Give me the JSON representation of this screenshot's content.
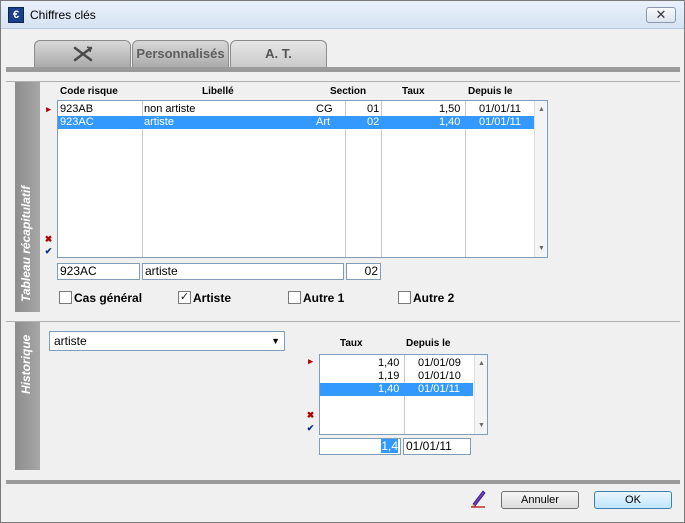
{
  "window": {
    "title": "Chiffres clés"
  },
  "tabs": [
    {
      "label": ""
    },
    {
      "label": "Personnalisés"
    },
    {
      "label": "A. T."
    }
  ],
  "summary": {
    "section_label": "Tableau récapitulatif",
    "columns": [
      "Code risque",
      "Libellé",
      "Section",
      "Taux",
      "Depuis le"
    ],
    "rows": [
      {
        "code": "923AB",
        "libelle": "non artiste",
        "section_code": "CG",
        "section_num": "01",
        "taux": "1,50",
        "depuis": "01/01/11",
        "selected": false
      },
      {
        "code": "923AC",
        "libelle": "artiste",
        "section_code": "Art",
        "section_num": "02",
        "taux": "1,40",
        "depuis": "01/01/11",
        "selected": true
      }
    ],
    "edit": {
      "code": "923AC",
      "libelle": "artiste",
      "section": "02"
    },
    "checkboxes": [
      {
        "label": "Cas général",
        "checked": false
      },
      {
        "label": "Artiste",
        "checked": true
      },
      {
        "label": "Autre 1",
        "checked": false
      },
      {
        "label": "Autre 2",
        "checked": false
      }
    ]
  },
  "history": {
    "section_label": "Historique",
    "dropdown_value": "artiste",
    "columns": [
      "Taux",
      "Depuis le"
    ],
    "rows": [
      {
        "taux": "1,40",
        "depuis": "01/01/09",
        "selected": false
      },
      {
        "taux": "1,19",
        "depuis": "01/01/10",
        "selected": false
      },
      {
        "taux": "1,40",
        "depuis": "01/01/11",
        "selected": true
      }
    ],
    "edit": {
      "taux": "1,4",
      "depuis": "01/01/11"
    }
  },
  "footer": {
    "cancel_label": "Annuler",
    "ok_label": "OK"
  }
}
